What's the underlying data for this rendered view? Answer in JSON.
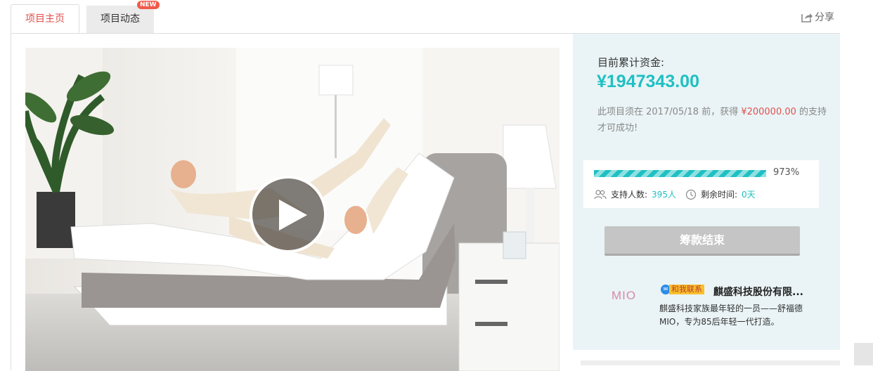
{
  "tabs": {
    "main_label": "项目主页",
    "news_label": "项目动态",
    "new_badge": "NEW"
  },
  "share": {
    "label": "分享",
    "icon": "share-icon"
  },
  "video": {
    "icon": "play-icon"
  },
  "funding": {
    "raised_label": "目前累计资金:",
    "raised_amount": "¥1947343.00",
    "deadline_prefix": "此项目须在 2017/05/18 前，获得 ",
    "goal_amount": "¥200000.00",
    "deadline_suffix": " 的支持才可成功!",
    "progress_percent": 973,
    "progress_label": "973%",
    "supporters_label": "支持人数:",
    "supporters_value": "395人",
    "time_left_label": "剩余时间:",
    "time_left_value": "0天",
    "ended_button": "筹款结束"
  },
  "sponsor": {
    "logo_text": "MIO",
    "contact_label": "和我联系",
    "company_name": "麒盛科技股份有限...",
    "description": "麒盛科技家族最年轻的一员——舒福德MIO，专为85后年轻一代打造。"
  },
  "colors": {
    "accent": "#1fc0c3",
    "highlight_red": "#e0504e",
    "panel_bg": "#eaf4f6",
    "ended_button": "#c5c5c5"
  }
}
